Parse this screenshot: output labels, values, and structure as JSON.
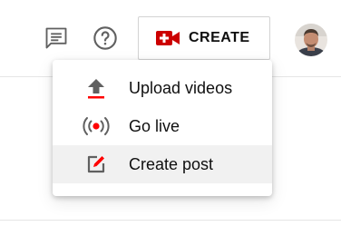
{
  "header": {
    "messages_icon": "feedback-icon",
    "help_icon": "help-icon",
    "create_button": {
      "label": "CREATE",
      "icon": "video-camera-plus-icon",
      "icon_color": "#cc0000"
    },
    "avatar": "user-avatar"
  },
  "create_menu": {
    "items": [
      {
        "label": "Upload videos",
        "icon": "upload-icon",
        "accent": "#ff0000"
      },
      {
        "label": "Go live",
        "icon": "live-broadcast-icon",
        "accent": "#ff0000"
      },
      {
        "label": "Create post",
        "icon": "edit-post-icon",
        "accent": "#ff0000",
        "hovered": true
      }
    ]
  }
}
